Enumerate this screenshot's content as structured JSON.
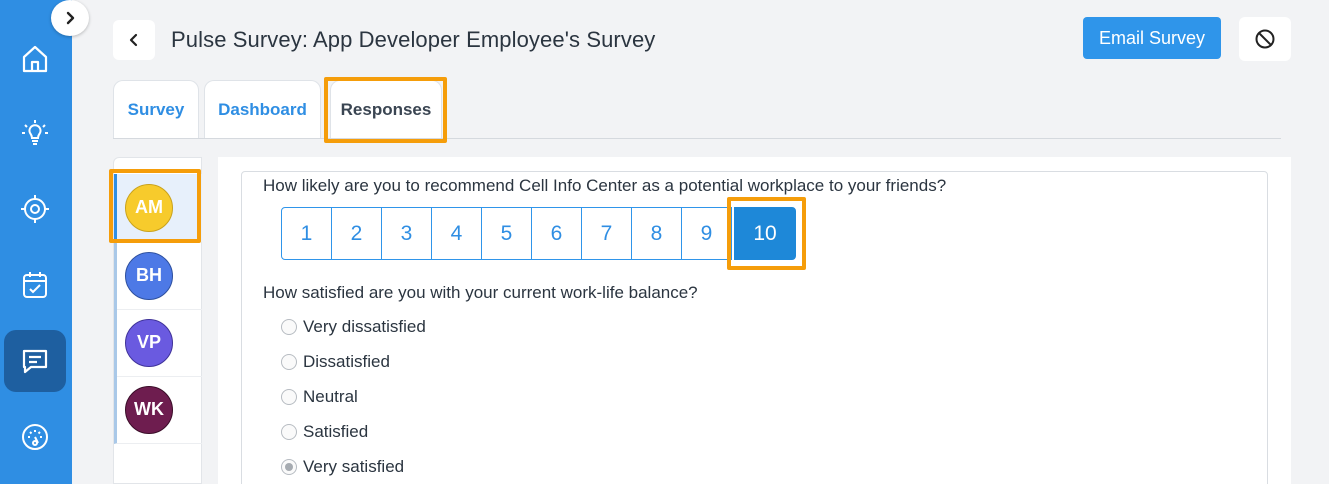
{
  "header": {
    "title": "Pulse Survey: App Developer Employee's Survey",
    "email_label": "Email Survey"
  },
  "sidebar": {
    "items": [
      {
        "icon": "home-icon"
      },
      {
        "icon": "lightbulb-icon"
      },
      {
        "icon": "target-icon"
      },
      {
        "icon": "calendar-check-icon"
      },
      {
        "icon": "chat-icon",
        "active": true
      },
      {
        "icon": "gauge-icon"
      }
    ]
  },
  "tabs": [
    {
      "label": "Survey"
    },
    {
      "label": "Dashboard"
    },
    {
      "label": "Responses",
      "active": true
    }
  ],
  "respondents": [
    {
      "initials": "AM",
      "color": "#f7cb2c",
      "selected": true
    },
    {
      "initials": "BH",
      "color": "#4d79e6"
    },
    {
      "initials": "VP",
      "color": "#6a5ae0"
    },
    {
      "initials": "WK",
      "color": "#6e1d4f"
    }
  ],
  "questions": [
    {
      "text": "How likely are you to recommend Cell Info Center as a potential workplace to your friends?",
      "scale": [
        "1",
        "2",
        "3",
        "4",
        "5",
        "6",
        "7",
        "8",
        "9",
        "10"
      ],
      "selected": "10"
    },
    {
      "text": "How satisfied are you with your current work-life balance?",
      "options": [
        "Very dissatisfied",
        "Dissatisfied",
        "Neutral",
        "Satisfied",
        "Very satisfied"
      ],
      "selected": "Very satisfied"
    }
  ],
  "colors": {
    "sidebar": "#2f8ee3",
    "accent": "#2f95ea",
    "highlight": "#f59d0a"
  }
}
